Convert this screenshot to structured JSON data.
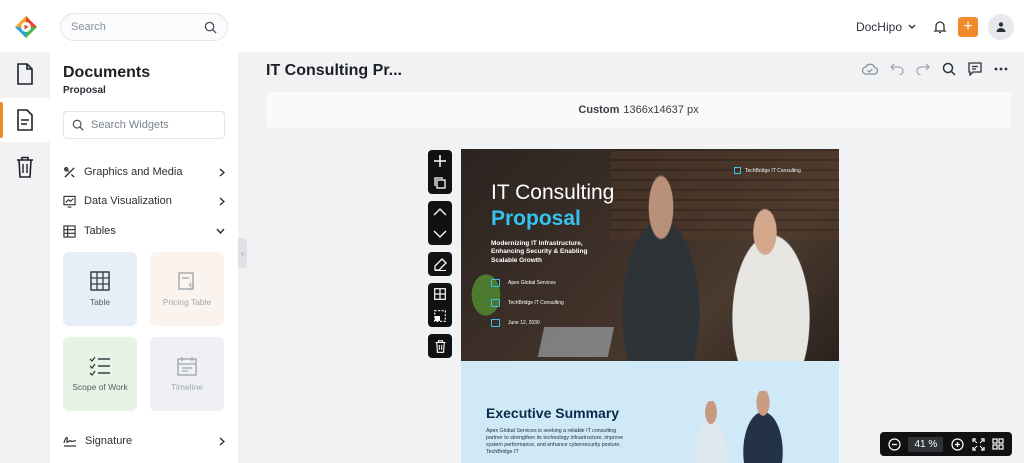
{
  "search": {
    "placeholder": "Search"
  },
  "header": {
    "brand": "DocHipo",
    "plus": "+"
  },
  "panel": {
    "title": "Documents",
    "subtitle": "Proposal",
    "widget_search": "Search Widgets",
    "categories": [
      "Graphics and Media",
      "Data Visualization",
      "Tables"
    ],
    "tiles": [
      "Table",
      "Pricing Table",
      "Scope of Work",
      "Timeline"
    ],
    "signature": "Signature"
  },
  "document": {
    "title": "IT Consulting Pr...",
    "size_label": "Custom",
    "size_value": "1366x14637 px"
  },
  "page": {
    "brand": "TechBridge IT Consulting",
    "title_line1": "IT Consulting",
    "title_line2": "Proposal",
    "description": "Modernizing IT Infrastructure, Enhancing Security & Enabling Scalable Growth",
    "info": [
      "Apex Global Services",
      "TechBridge IT Consulting",
      "June 12, 2030"
    ],
    "exec_title": "Executive Summary",
    "exec_text": "Apex Global Services is seeking a reliable IT consulting partner to strengthen its technology infrastructure, improve system performance, and enhance cybersecurity posture. TechBridge IT"
  },
  "zoom": {
    "value": "41 %"
  },
  "colors": {
    "accent": "#f08a2b",
    "cyan": "#34c3f0",
    "navy": "#0b2a4a"
  }
}
